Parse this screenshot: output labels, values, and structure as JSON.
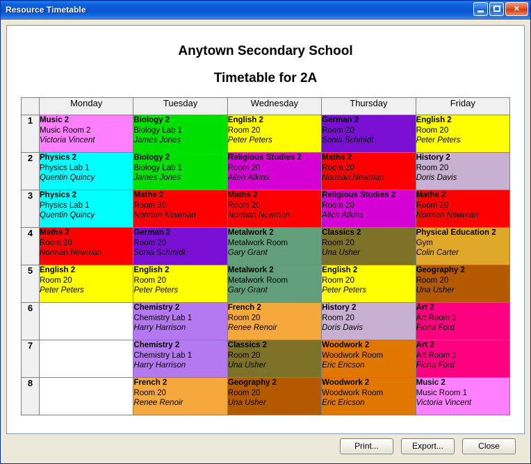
{
  "window": {
    "title": "Resource Timetable",
    "controls": {
      "minimize": "minimize-button",
      "maximize": "maximize-button",
      "close": "close-button"
    }
  },
  "header": {
    "school_name": "Anytown Secondary School",
    "timetable_title": "Timetable for 2A"
  },
  "table": {
    "corner_label": "",
    "days": [
      "Monday",
      "Tuesday",
      "Wednesday",
      "Thursday",
      "Friday"
    ],
    "periods": [
      "1",
      "2",
      "3",
      "4",
      "5",
      "6",
      "7",
      "8"
    ],
    "rows": [
      {
        "period": "1",
        "cells": [
          {
            "subject": "Music 2",
            "room": "Music Room 2",
            "teacher": "Victoria Vincent",
            "color": "#FF80FF"
          },
          {
            "subject": "Biology 2",
            "room": "Biology Lab 1",
            "teacher": "James Jones",
            "color": "#00E000"
          },
          {
            "subject": "English 2",
            "room": "Room 20",
            "teacher": "Peter Peters",
            "color": "#FFFF00"
          },
          {
            "subject": "German 2",
            "room": "Room 20",
            "teacher": "Sonia Schmidt",
            "color": "#7A0FD4"
          },
          {
            "subject": "English 2",
            "room": "Room 20",
            "teacher": "Peter Peters",
            "color": "#FFFF00"
          }
        ]
      },
      {
        "period": "2",
        "cells": [
          {
            "subject": "Physics 2",
            "room": "Physics Lab 1",
            "teacher": "Quentin Quincy",
            "color": "#00FFFF"
          },
          {
            "subject": "Biology 2",
            "room": "Biology Lab 1",
            "teacher": "James Jones",
            "color": "#00E000"
          },
          {
            "subject": "Religious Studies 2",
            "room": "Room 20",
            "teacher": "Allen Atkins",
            "color": "#D400D4"
          },
          {
            "subject": "Maths 2",
            "room": "Room 20",
            "teacher": "Norman Newman",
            "color": "#FF0000"
          },
          {
            "subject": "History 2",
            "room": "Room 20",
            "teacher": "Doris Davis",
            "color": "#C8B0D2"
          }
        ]
      },
      {
        "period": "3",
        "cells": [
          {
            "subject": "Physics 2",
            "room": "Physics Lab 1",
            "teacher": "Quentin Quincy",
            "color": "#00FFFF"
          },
          {
            "subject": "Maths 2",
            "room": "Room 30",
            "teacher": "Norman Newman",
            "color": "#FF0000"
          },
          {
            "subject": "Maths 2",
            "room": "Room 20",
            "teacher": "Norman Newman",
            "color": "#FF0000"
          },
          {
            "subject": "Religious Studies 2",
            "room": "Room 20",
            "teacher": "Allen Atkins",
            "color": "#D400D4"
          },
          {
            "subject": "Maths 2",
            "room": "Room 20",
            "teacher": "Norman Newman",
            "color": "#FF0000"
          }
        ]
      },
      {
        "period": "4",
        "cells": [
          {
            "subject": "Maths 2",
            "room": "Room 20",
            "teacher": "Norman Newman",
            "color": "#FF0000"
          },
          {
            "subject": "German 2",
            "room": "Room 20",
            "teacher": "Sonia Schmidt",
            "color": "#7A0FD4"
          },
          {
            "subject": "Metalwork 2",
            "room": "Metalwork Room",
            "teacher": "Gary Grant",
            "color": "#62A07B"
          },
          {
            "subject": "Classics 2",
            "room": "Room 20",
            "teacher": "Una Usher",
            "color": "#7E7229"
          },
          {
            "subject": "Physical Education 2",
            "room": "Gym",
            "teacher": "Colin Carter",
            "color": "#E0A828"
          }
        ]
      },
      {
        "period": "5",
        "cells": [
          {
            "subject": "English 2",
            "room": "Room 20",
            "teacher": "Peter Peters",
            "color": "#FFFF00"
          },
          {
            "subject": "English 2",
            "room": "Room 20",
            "teacher": "Peter Peters",
            "color": "#FFFF00"
          },
          {
            "subject": "Metalwork 2",
            "room": "Metalwork Room",
            "teacher": "Gary Grant",
            "color": "#62A07B"
          },
          {
            "subject": "English 2",
            "room": "Room 20",
            "teacher": "Peter Peters",
            "color": "#FFFF00"
          },
          {
            "subject": "Geography 2",
            "room": "Room 20",
            "teacher": "Una Usher",
            "color": "#B35A00"
          }
        ]
      },
      {
        "period": "6",
        "cells": [
          {
            "subject": "",
            "room": "",
            "teacher": "",
            "color": "#FFFFFF"
          },
          {
            "subject": "Chemistry 2",
            "room": "Chemistry Lab 1",
            "teacher": "Harry Harrison",
            "color": "#B478F0"
          },
          {
            "subject": "French 2",
            "room": "Room 20",
            "teacher": "Renee Renoir",
            "color": "#F5A83C"
          },
          {
            "subject": "History 2",
            "room": "Room 20",
            "teacher": "Doris Davis",
            "color": "#C8B0D2"
          },
          {
            "subject": "Art 2",
            "room": "Art Room 1",
            "teacher": "Fiona Ford",
            "color": "#FF0080"
          }
        ]
      },
      {
        "period": "7",
        "cells": [
          {
            "subject": "",
            "room": "",
            "teacher": "",
            "color": "#FFFFFF"
          },
          {
            "subject": "Chemistry 2",
            "room": "Chemistry Lab 1",
            "teacher": "Harry Harrison",
            "color": "#B478F0"
          },
          {
            "subject": "Classics 2",
            "room": "Room 20",
            "teacher": "Una Usher",
            "color": "#7E7229"
          },
          {
            "subject": "Woodwork 2",
            "room": "Woodwork Room",
            "teacher": "Eric Ericson",
            "color": "#E07800"
          },
          {
            "subject": "Art 2",
            "room": "Art Room 1",
            "teacher": "Fiona Ford",
            "color": "#FF0080"
          }
        ]
      },
      {
        "period": "8",
        "cells": [
          {
            "subject": "",
            "room": "",
            "teacher": "",
            "color": "#FFFFFF"
          },
          {
            "subject": "French 2",
            "room": "Room 20",
            "teacher": "Renee Renoir",
            "color": "#F5A83C"
          },
          {
            "subject": "Geography 2",
            "room": "Room 20",
            "teacher": "Una Usher",
            "color": "#B35A00"
          },
          {
            "subject": "Woodwork 2",
            "room": "Woodwork Room",
            "teacher": "Eric Ericson",
            "color": "#E07800"
          },
          {
            "subject": "Music 2",
            "room": "Music Room 1",
            "teacher": "Victoria Vincent",
            "color": "#FF80FF"
          }
        ]
      }
    ]
  },
  "footer": {
    "print_label": "Print...",
    "export_label": "Export...",
    "close_label": "Close"
  }
}
